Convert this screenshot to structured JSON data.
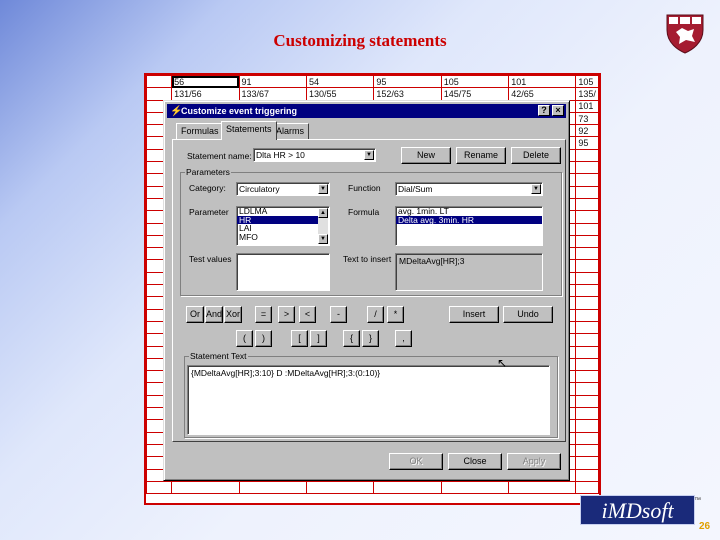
{
  "slide": {
    "title": "Customizing statements",
    "page_number": "26"
  },
  "spreadsheet": {
    "rows": [
      [
        "56",
        "91",
        "54",
        "95",
        "105",
        "101",
        "105"
      ],
      [
        "131/56",
        "133/67",
        "130/55",
        "152/63",
        "145/75",
        "42/65",
        "135/"
      ],
      [
        "",
        "",
        "",
        "",
        "",
        "",
        "101"
      ],
      [
        "",
        "",
        "",
        "",
        "",
        "",
        "73"
      ],
      [
        "",
        "",
        "",
        "",
        "",
        "",
        "92"
      ],
      [
        "",
        "",
        "",
        "",
        "",
        "",
        "95"
      ]
    ]
  },
  "dialog": {
    "title": "Customize event triggering",
    "help_label": "?",
    "close_label": "×",
    "tabs": [
      "Formulas",
      "Statements",
      "Alarms"
    ],
    "statement_name_label": "Statement name:",
    "statement_name_value": "Dlta HR > 10",
    "new_button": "New",
    "rename_button": "Rename",
    "delete_button": "Delete",
    "parameters_legend": "Parameters",
    "category_label": "Category:",
    "category_value": "Circulatory",
    "function_label": "Function",
    "function_value": "Dial/Sum",
    "parameter_label": "Parameter",
    "parameter_items": [
      "LDLMA",
      "HR",
      "LAI",
      "MFO"
    ],
    "parameter_selected": 1,
    "formula_label": "Formula",
    "formula_items": [
      "avg. 1min. LT",
      "Delta avg. 3min. HR"
    ],
    "formula_selected": 1,
    "test_values_label": "Test values",
    "text_to_insert_label": "Text to insert",
    "text_to_insert_value": "MDeltaAvg[HR];3",
    "operators": [
      "Or",
      "And",
      "Xor",
      "=",
      ">",
      "<",
      "-",
      "/",
      "*"
    ],
    "brackets": [
      "(",
      ")",
      "[",
      "]",
      "{",
      "}",
      ","
    ],
    "insert_button": "Insert",
    "undo_button": "Undo",
    "statement_text_legend": "Statement Text",
    "statement_text_value": "{MDeltaAvg[HR];3:10} D :MDeltaAvg[HR];3:(0:10)}",
    "ok_button": "OK",
    "close_button": "Close",
    "apply_button": "Apply"
  },
  "logo": {
    "text": "MDsoft",
    "prefix": "i",
    "tm": "™"
  }
}
